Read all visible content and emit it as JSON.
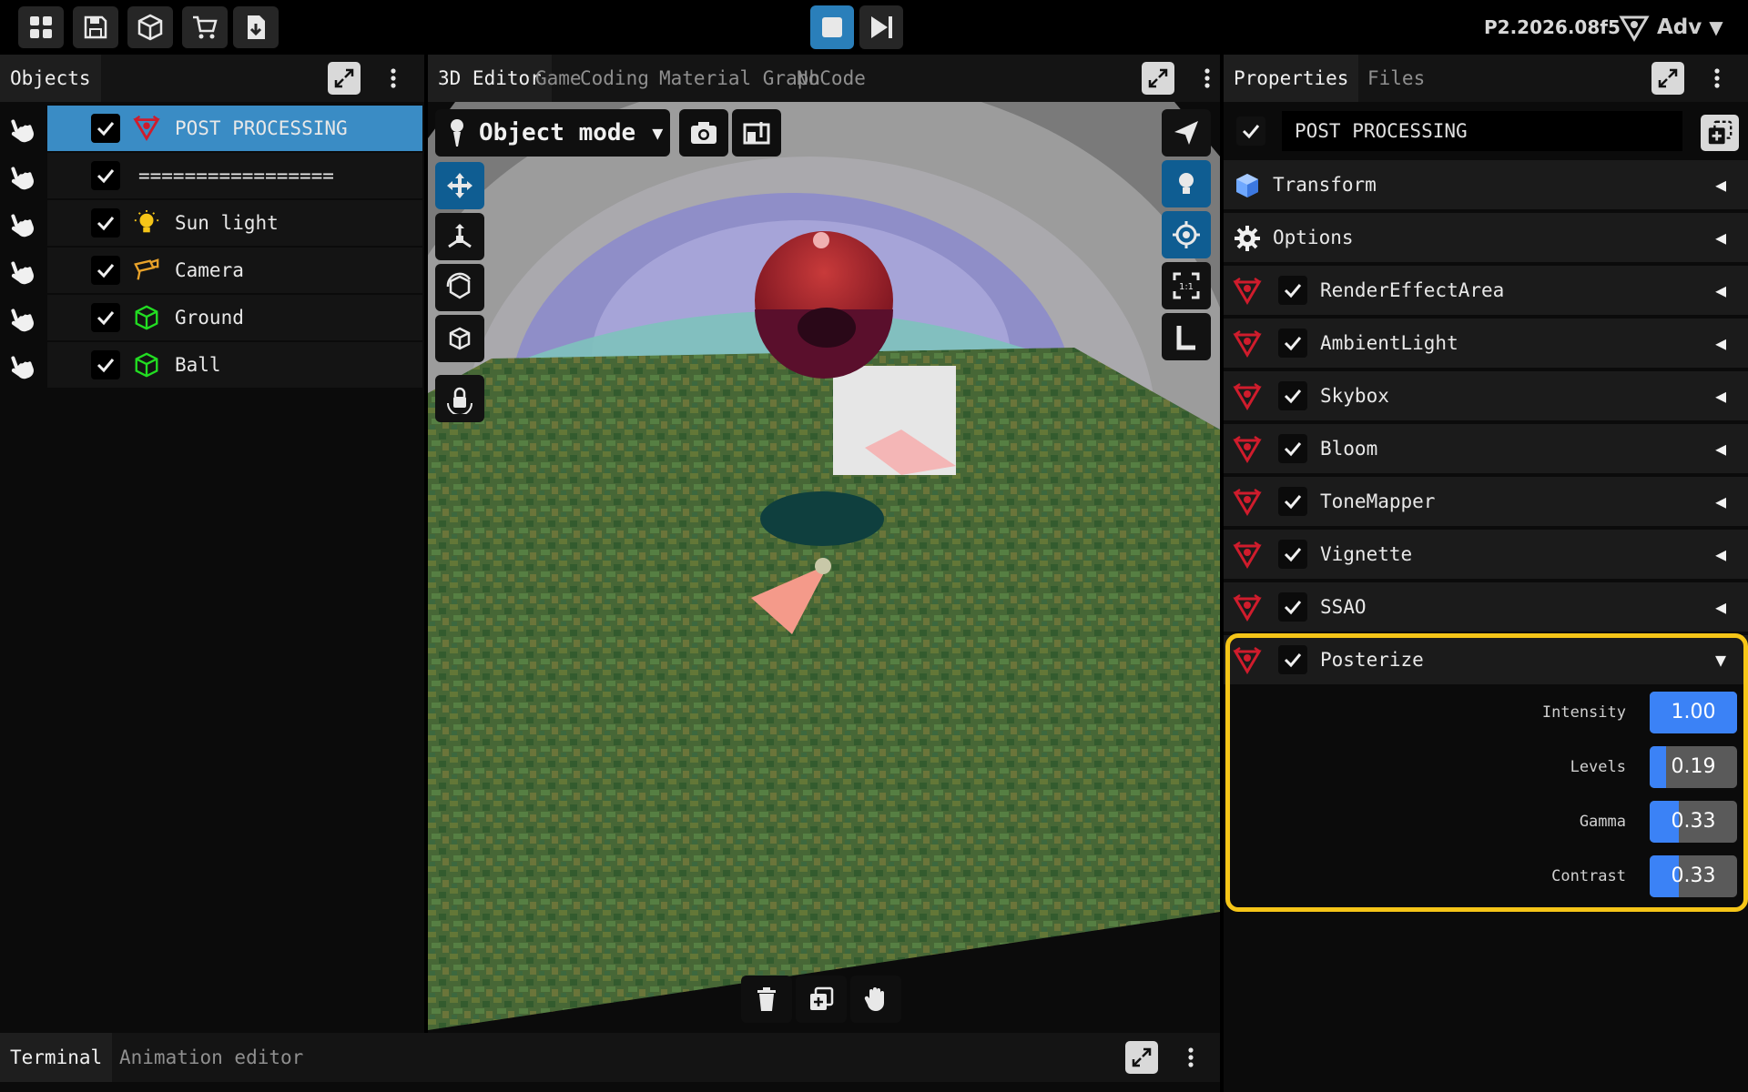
{
  "topbar": {
    "buttons": [
      "grid-icon",
      "save-icon",
      "cube-icon",
      "cart-icon",
      "import-icon"
    ],
    "version": "P2.2026.08f5",
    "mode_label": "Adv"
  },
  "objects": {
    "tab": "Objects",
    "items": [
      {
        "label": "POST PROCESSING",
        "icon": "post-processing-icon",
        "checked": true,
        "selected": true
      },
      {
        "label": "=================",
        "icon": "",
        "checked": true,
        "selected": false
      },
      {
        "label": "Sun light",
        "icon": "bulb-icon",
        "checked": true,
        "selected": false
      },
      {
        "label": "Camera",
        "icon": "camera-icon",
        "checked": true,
        "selected": false
      },
      {
        "label": "Ground",
        "icon": "mesh-icon",
        "checked": true,
        "selected": false
      },
      {
        "label": "Ball",
        "icon": "mesh-icon",
        "checked": true,
        "selected": false
      }
    ]
  },
  "editor": {
    "tabs": [
      "3D Editor",
      "Game",
      "Coding",
      "Material Graph",
      "NoCode"
    ],
    "mode": "Object mode"
  },
  "properties": {
    "tabs": [
      "Properties",
      "Files"
    ],
    "object_name": "POST PROCESSING",
    "sections": [
      {
        "label": "Transform",
        "icon": "cube-icon"
      },
      {
        "label": "Options",
        "icon": "gear-icon"
      }
    ],
    "effects": [
      {
        "label": "RenderEffectArea",
        "checked": true
      },
      {
        "label": "AmbientLight",
        "checked": true
      },
      {
        "label": "Skybox",
        "checked": true
      },
      {
        "label": "Bloom",
        "checked": true
      },
      {
        "label": "ToneMapper",
        "checked": true
      },
      {
        "label": "Vignette",
        "checked": true
      },
      {
        "label": "SSAO",
        "checked": true
      },
      {
        "label": "Posterize",
        "checked": true,
        "expanded": true
      }
    ],
    "posterize_params": [
      {
        "label": "Intensity",
        "value": "1.00",
        "fraction": 1.0
      },
      {
        "label": "Levels",
        "value": "0.19",
        "fraction": 0.19
      },
      {
        "label": "Gamma",
        "value": "0.33",
        "fraction": 0.33
      },
      {
        "label": "Contrast",
        "value": "0.33",
        "fraction": 0.33
      }
    ]
  },
  "terminal": {
    "tabs": [
      "Terminal",
      "Animation editor"
    ]
  },
  "colors": {
    "accent_blue": "#3a8cc5",
    "highlight": "#f5c518",
    "slider_fill": "#3b82f6",
    "mesh_green": "#22dd22",
    "post_red": "#d01c2c"
  }
}
